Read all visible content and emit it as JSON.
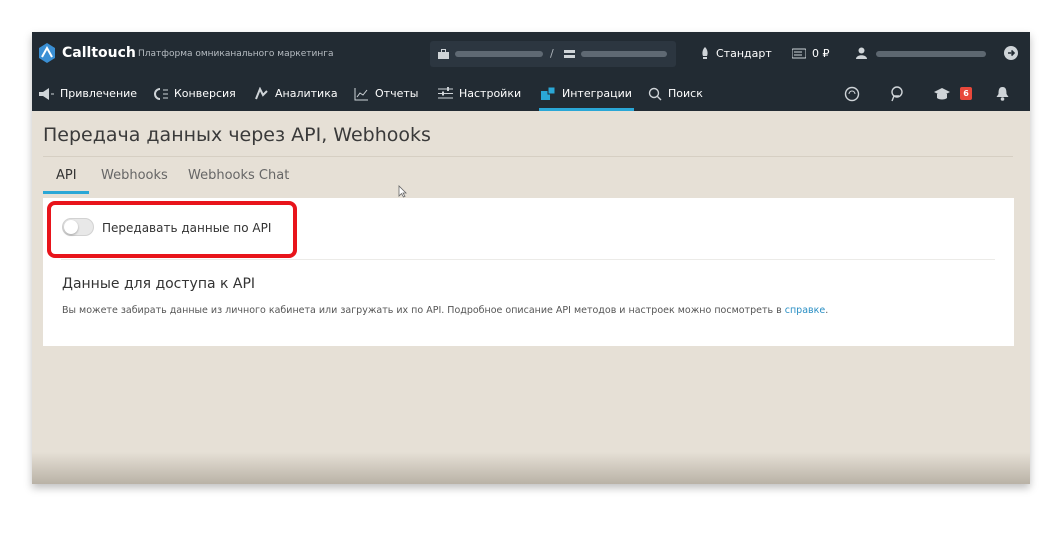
{
  "header": {
    "brand": "Calltouch",
    "tagline": "Платформа омниканального маркетинга",
    "account_separator": "/",
    "plan": "Стандарт",
    "balance": "0 ₽"
  },
  "nav": {
    "items": [
      {
        "label": "Привлечение",
        "icon": "megaphone-icon"
      },
      {
        "label": "Конверсия",
        "icon": "conversion-icon"
      },
      {
        "label": "Аналитика",
        "icon": "analytics-icon"
      },
      {
        "label": "Отчеты",
        "icon": "reports-chart-icon"
      },
      {
        "label": "Настройки",
        "icon": "settings-sliders-icon"
      },
      {
        "label": "Интеграции",
        "icon": "integrations-puzzle-icon",
        "active": true
      },
      {
        "label": "Поиск",
        "icon": "search-icon"
      }
    ],
    "badge_count": "6"
  },
  "page": {
    "title": "Передача данных через API, Webhooks",
    "tabs": [
      {
        "label": "API",
        "active": true
      },
      {
        "label": "Webhooks"
      },
      {
        "label": "Webhooks Chat"
      }
    ]
  },
  "api_panel": {
    "toggle_label": "Передавать данные по API",
    "toggle_on": false,
    "section_title": "Данные для доступа к API",
    "description": "Вы можете забирать данные из личного кабинета или загружать их по API. Подробное описание API методов и настроек можно посмотреть в ",
    "help_link": "справке",
    "description_end": "."
  },
  "colors": {
    "topbar": "#222b33",
    "accent": "#2aa7d6",
    "highlight": "#e8141b",
    "background": "#e6e0d6"
  }
}
